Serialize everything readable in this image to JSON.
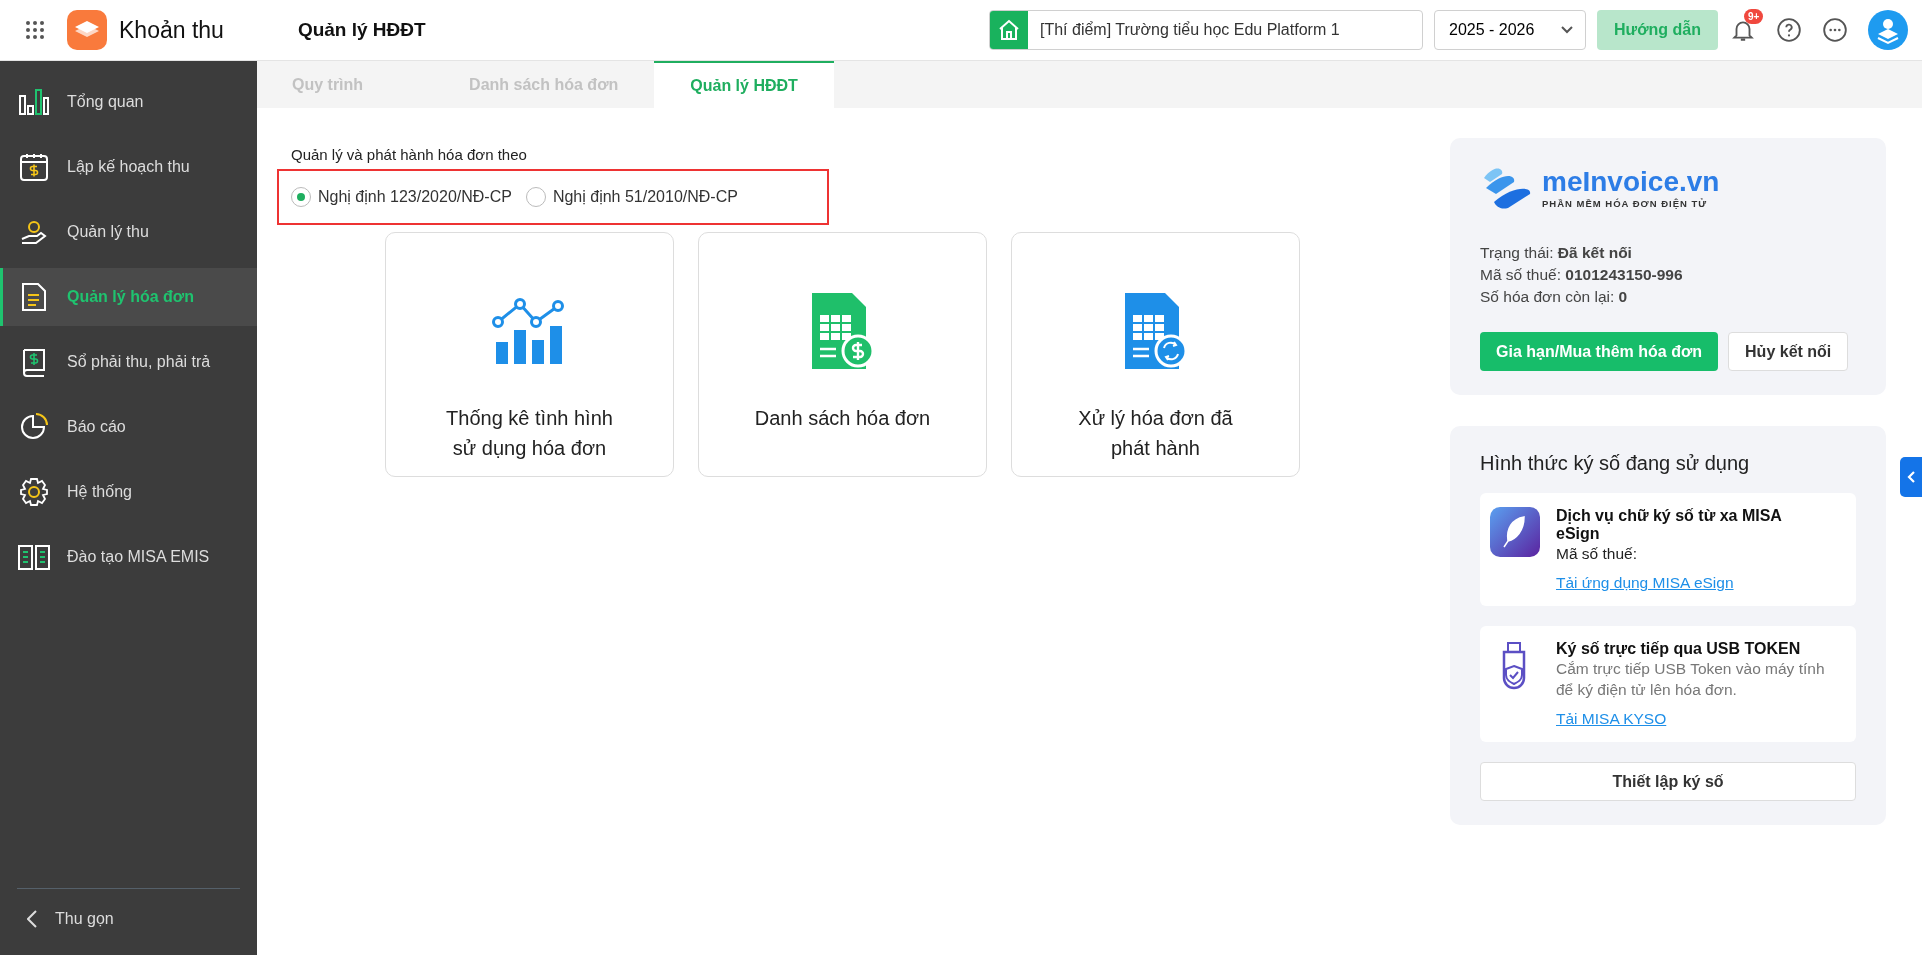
{
  "header": {
    "app_name": "Khoản thu",
    "page_title": "Quản lý HĐĐT",
    "school": "[Thí điểm] Trường tiểu học Edu Platform 1",
    "school_year": "2025 - 2026",
    "guide_button": "Hướng dẫn",
    "notification_badge": "9+"
  },
  "sidebar": {
    "items": [
      {
        "label": "Tổng quan",
        "selected": false
      },
      {
        "label": "Lập kế hoạch thu",
        "selected": false
      },
      {
        "label": "Quản lý thu",
        "selected": false
      },
      {
        "label": "Quản lý hóa đơn",
        "selected": true
      },
      {
        "label": "Sổ phải thu, phải trả",
        "selected": false
      },
      {
        "label": "Báo cáo",
        "selected": false
      },
      {
        "label": "Hệ thống",
        "selected": false
      },
      {
        "label": "Đào tạo MISA EMIS",
        "selected": false
      }
    ],
    "collapse": "Thu gọn"
  },
  "tabs": [
    {
      "label": "Quy trình",
      "selected": false
    },
    {
      "label": "Danh sách hóa đơn",
      "selected": false
    },
    {
      "label": "Quản lý HĐĐT",
      "selected": true
    }
  ],
  "invoice_mode": {
    "label": "Quản lý và phát hành hóa đơn theo",
    "options": [
      {
        "label": "Nghị định 123/2020/NĐ-CP",
        "selected": true
      },
      {
        "label": "Nghị định 51/2010/NĐ-CP",
        "selected": false
      }
    ]
  },
  "cards": [
    {
      "label": "Thống kê tình hình sử dụng hóa đơn"
    },
    {
      "label": "Danh sách hóa đơn"
    },
    {
      "label": "Xử lý hóa đơn đã phát hành"
    }
  ],
  "provider": {
    "logo_name": "meInvoice.vn",
    "logo_tagline": "PHẦN MỀM HÓA ĐƠN ĐIỆN TỬ",
    "details": [
      "Trạng thái: **Đã kết nối**",
      "Mã số thuế: **0101243150-996**",
      "Số hóa đơn còn lại: **0**"
    ],
    "renew_button": "Gia hạn/Mua thêm hóa đơn",
    "disconnect_button": "Hủy kết nối"
  },
  "signing": {
    "title": "Hình thức ký số đang sử dụng",
    "methods": [
      {
        "title": "Dịch vụ chữ ký số từ xa MISA eSign",
        "text": "Mã số thuế:",
        "link": "Tải ứng dụng MISA eSign"
      },
      {
        "title": "Ký số trực tiếp qua USB TOKEN",
        "text": "Cắm trực tiếp USB Token vào máy tính để ký điện tử lên hóa đơn.",
        "link": "Tải MISA KYSO"
      }
    ],
    "setup_button": "Thiết lập ký số"
  }
}
